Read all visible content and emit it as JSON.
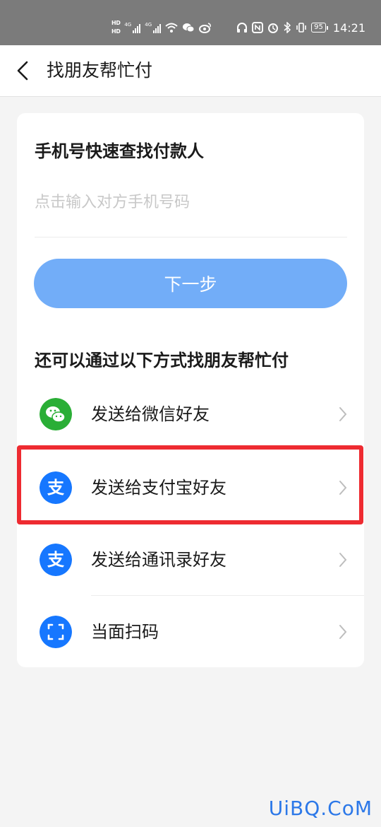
{
  "status_bar": {
    "time": "14:21",
    "battery": "95",
    "hd_labels": [
      "HD",
      "HD"
    ],
    "network_labels": [
      "4G",
      "4G"
    ],
    "icons": [
      "wifi-icon",
      "wechat-icon",
      "weibo-icon",
      "headphones-icon",
      "nfc-icon",
      "alarm-icon",
      "bluetooth-icon",
      "vibrate-icon",
      "battery-icon"
    ]
  },
  "nav": {
    "title": "找朋友帮忙付"
  },
  "phone_section": {
    "title": "手机号快速查找付款人",
    "input_placeholder": "点击输入对方手机号码",
    "input_value": "",
    "next_button": "下一步"
  },
  "alt_section": {
    "title": "还可以通过以下方式找朋友帮忙付",
    "options": [
      {
        "label": "发送给微信好友",
        "icon": "wechat-icon",
        "color": "#2aae36"
      },
      {
        "label": "发送给支付宝好友",
        "icon": "alipay-icon",
        "color": "#1677ff",
        "glyph": "支"
      },
      {
        "label": "发送给通讯录好友",
        "icon": "alipay-icon",
        "color": "#1677ff",
        "glyph": "支"
      },
      {
        "label": "当面扫码",
        "icon": "scan-icon",
        "color": "#1677ff"
      }
    ]
  },
  "highlight": {
    "color": "#ee2b31",
    "target": "发送给支付宝好友"
  },
  "watermark": "UiBQ.CoM",
  "colors": {
    "accent": "#1677ff",
    "button": "#72adf8",
    "placeholder": "#c8c8c8",
    "background": "#f4f4f4"
  }
}
